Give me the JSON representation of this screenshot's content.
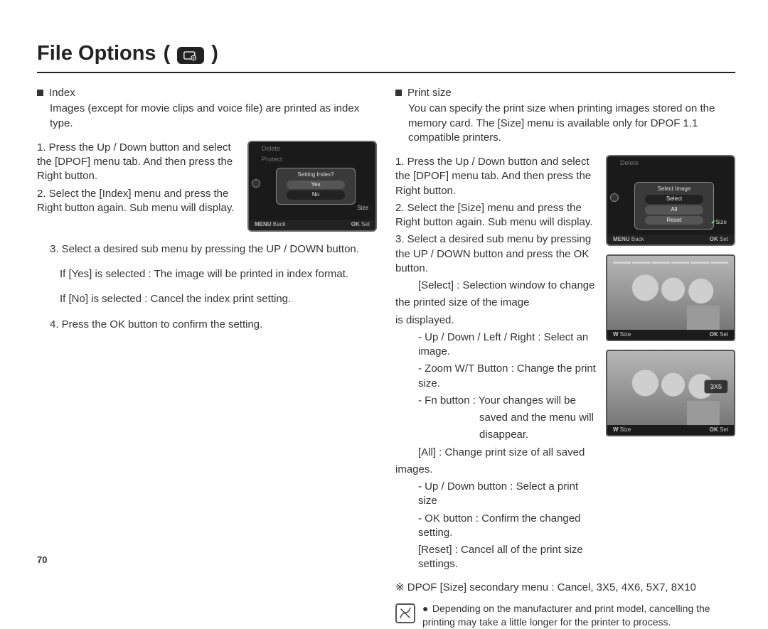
{
  "title": "File Options",
  "pageNumber": "70",
  "left": {
    "heading": "Index",
    "lead": "Images (except for movie clips and voice file) are printed as index type.",
    "step1": "1. Press the Up / Down button and select the [DPOF] menu tab. And then press the Right button.",
    "step2": "2. Select the [Index] menu and press the Right button again. Sub menu will display.",
    "step3": "3. Select a desired sub menu by pressing the UP / DOWN button.",
    "step3a": "If [Yes] is selected : The image will be printed in index format.",
    "step3b": "If [No] is selected   : Cancel the index print setting.",
    "step4": "4. Press the OK button to confirm the setting.",
    "lcd": {
      "top1": "Delete",
      "top2": "Protect",
      "panelHdr": "Setting Index?",
      "opt1": "Yes",
      "opt2": "No",
      "side": "Size",
      "backLabel": "Back",
      "setLabel": "Set",
      "menuKey": "MENU",
      "okKey": "OK"
    }
  },
  "right": {
    "heading": "Print size",
    "lead": "You can specify the print size when printing images stored on the memory card. The [Size] menu is available only for DPOF 1.1 compatible printers.",
    "step1": "1. Press the Up / Down button and select the [DPOF] menu tab. And then press the Right button.",
    "step2": "2. Select the [Size] menu and press the Right button again. Sub menu will display.",
    "step3": "3. Select a desired sub menu by pressing the UP / DOWN button and press the OK button.",
    "sel": "[Select] : Selection window to change",
    "sel1": "the printed size of the image",
    "sel2": "is displayed.",
    "selA": "- Up / Down / Left / Right : Select an image.",
    "selB": "- Zoom W/T Button : Change the print size.",
    "selC": "- Fn button : Your changes will be",
    "selC1": "saved and the menu will",
    "selC2": "disappear.",
    "all": "[All] : Change print size of all saved",
    "all1": "images.",
    "allA": "- Up / Down button : Select a print size",
    "allB": "- OK button : Confirm the changed setting.",
    "reset": "[Reset] : Cancel all of the print size settings.",
    "secondary": "※ DPOF [Size] secondary menu : Cancel, 3X5, 4X6, 5X7, 8X10",
    "lcd": {
      "top1": "Delete",
      "panelHdr": "Select Image",
      "opt1": "Select",
      "opt2": "All",
      "opt3": "Reset",
      "side": "Size",
      "backLabel": "Back",
      "setLabel": "Set",
      "menuKey": "MENU",
      "okKey": "OK"
    },
    "thumb1": {
      "sizeLabel": "Size",
      "setLabel": "Set",
      "wKey": "W",
      "okKey": "OK"
    },
    "thumb2": {
      "badge": "3X5",
      "sizeLabel": "Size",
      "setLabel": "Set",
      "wKey": "W",
      "okKey": "OK"
    }
  },
  "note": "Depending on the manufacturer and print model, cancelling the printing may take a little longer for the printer to process."
}
